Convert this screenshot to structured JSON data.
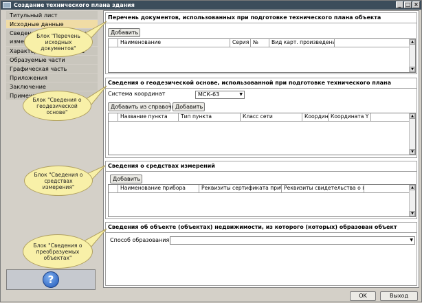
{
  "window": {
    "title": "Создание технического плана здания",
    "controls": [
      "_",
      "□",
      "×"
    ]
  },
  "sidebar": {
    "items": [
      {
        "label": "Титульный лист"
      },
      {
        "label": "Исходные данные"
      },
      {
        "label": "Сведения о выполненных измерениях и ог"
      },
      {
        "label": "Характеристики объекта"
      },
      {
        "label": "Образуемые части"
      },
      {
        "label": "Графическая часть"
      },
      {
        "label": "Приложения"
      },
      {
        "label": "Заключение"
      },
      {
        "label": "Примечание"
      }
    ],
    "active_index": 1,
    "help_label": "?"
  },
  "sections": {
    "documents": {
      "title": "Перечень документов, использованных при подготовке технического плана объекта",
      "add_label": "Добавить",
      "columns": [
        "Наименование",
        "Серия",
        "№",
        "Вид карт. произведения"
      ]
    },
    "geodetic": {
      "title": "Сведения о геодезической основе, использованной при подготовке технического плана",
      "coord_label": "Система координат",
      "coord_value": "МСК-63",
      "add_from_ref_label": "Добавить из справочника",
      "add_label": "Добавить",
      "columns": [
        "Название пункта",
        "Тип пункта",
        "Класс сети",
        "Координата X",
        "Координата Y"
      ]
    },
    "instruments": {
      "title": "Сведения о средствах измерений",
      "add_label": "Добавить",
      "columns": [
        "Наименование прибора",
        "Реквизиты сертификата прибора",
        "Реквизиты свидетельства о повер"
      ]
    },
    "objects": {
      "title": "Сведения об объекте (объектах) недвижимости, из которого (которых) образован объект",
      "method_label": "Способ образования",
      "method_value": ""
    }
  },
  "callouts": [
    {
      "text": "Блок \"Перечень исходных документов\""
    },
    {
      "text": "Блок \"Сведения о геодезической основе\""
    },
    {
      "text": "Блок \"Сведения о средствах измерения\""
    },
    {
      "text": "Блок \"Сведения о преобразуемых объектах\""
    }
  ],
  "footer": {
    "ok_label": "OK",
    "exit_label": "Выход"
  },
  "colors": {
    "titlebar": "#3c4d5b",
    "active_nav": "#f0dca5",
    "callout_fill": "#f8f0a8"
  }
}
